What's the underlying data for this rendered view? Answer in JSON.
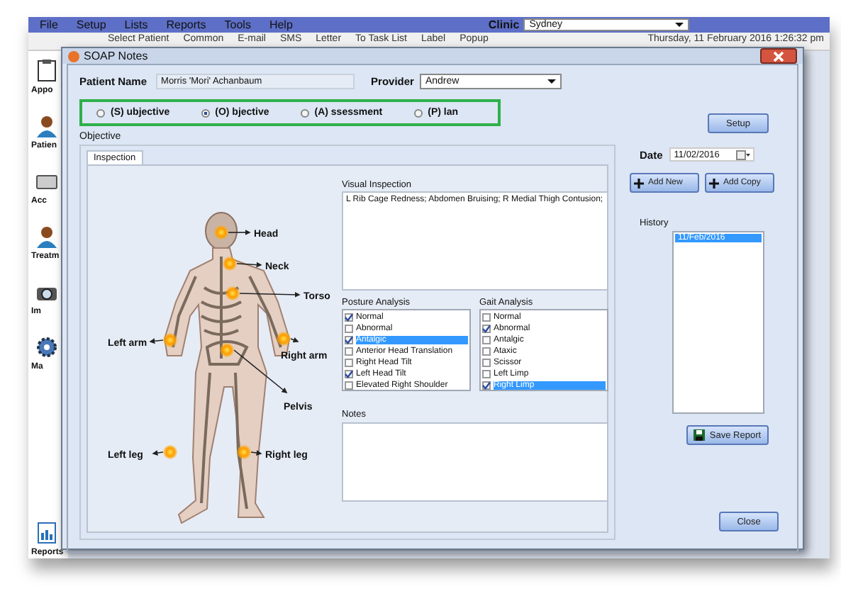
{
  "menu": [
    "File",
    "Setup",
    "Lists",
    "Reports",
    "Tools",
    "Help"
  ],
  "clinic": {
    "label": "Clinic",
    "value": "Sydney"
  },
  "toolbar": [
    "Select Patient",
    "Common",
    "E-mail",
    "SMS",
    "Letter",
    "To Task List",
    "Label",
    "Popup"
  ],
  "datetime": "Thursday, 11 February 2016 1:26:32 pm",
  "sidebar": {
    "items": [
      "Appo",
      "Patien",
      "Acc",
      "Treatm",
      "Im",
      "Ma",
      "Reports"
    ]
  },
  "dialog": {
    "title": "SOAP Notes",
    "patient_name": {
      "label": "Patient Name",
      "value": "Morris 'Mori' Achanbaum"
    },
    "provider": {
      "label": "Provider",
      "value": "Andrew"
    },
    "soap_options": [
      {
        "label": "(S) ubjective",
        "selected": false
      },
      {
        "label": "(O) bjective",
        "selected": true
      },
      {
        "label": "(A) ssessment",
        "selected": false
      },
      {
        "label": "(P) lan",
        "selected": false
      }
    ],
    "setup_button": "Setup",
    "group_title": "Objective",
    "tabs": [
      {
        "label": "Inspection",
        "selected": true
      }
    ],
    "body_parts": [
      "Head",
      "Neck",
      "Torso",
      "Left arm",
      "Right arm",
      "Pelvis",
      "Left leg",
      "Right leg"
    ],
    "visual_inspection": {
      "label": "Visual Inspection",
      "value": "L Rib Cage Redness; Abdomen Bruising; R Medial Thigh Contusion;"
    },
    "posture_analysis": {
      "label": "Posture Analysis",
      "items": [
        {
          "label": "Normal",
          "checked": true,
          "selected": false
        },
        {
          "label": "Abnormal",
          "checked": false,
          "selected": false
        },
        {
          "label": "Antalgic",
          "checked": true,
          "selected": true
        },
        {
          "label": "Anterior Head Translation",
          "checked": false,
          "selected": false
        },
        {
          "label": "Right Head Tilt",
          "checked": false,
          "selected": false
        },
        {
          "label": "Left Head Tilt",
          "checked": true,
          "selected": false
        },
        {
          "label": "Elevated Right Shoulder",
          "checked": false,
          "selected": false
        }
      ]
    },
    "gait_analysis": {
      "label": "Gait Analysis",
      "items": [
        {
          "label": "Normal",
          "checked": false,
          "selected": false
        },
        {
          "label": "Abnormal",
          "checked": true,
          "selected": false
        },
        {
          "label": "Antalgic",
          "checked": false,
          "selected": false
        },
        {
          "label": "Ataxic",
          "checked": false,
          "selected": false
        },
        {
          "label": "Scissor",
          "checked": false,
          "selected": false
        },
        {
          "label": "Left Limp",
          "checked": false,
          "selected": false
        },
        {
          "label": "Right Limp",
          "checked": true,
          "selected": true
        }
      ]
    },
    "notes": {
      "label": "Notes"
    },
    "date": {
      "label": "Date",
      "value": "11/02/2016"
    },
    "add_new": "Add New",
    "add_copy": "Add Copy",
    "history": {
      "label": "History",
      "items": [
        {
          "label": "11/Feb/2016",
          "selected": true
        }
      ]
    },
    "save_report": "Save Report",
    "close": "Close"
  }
}
